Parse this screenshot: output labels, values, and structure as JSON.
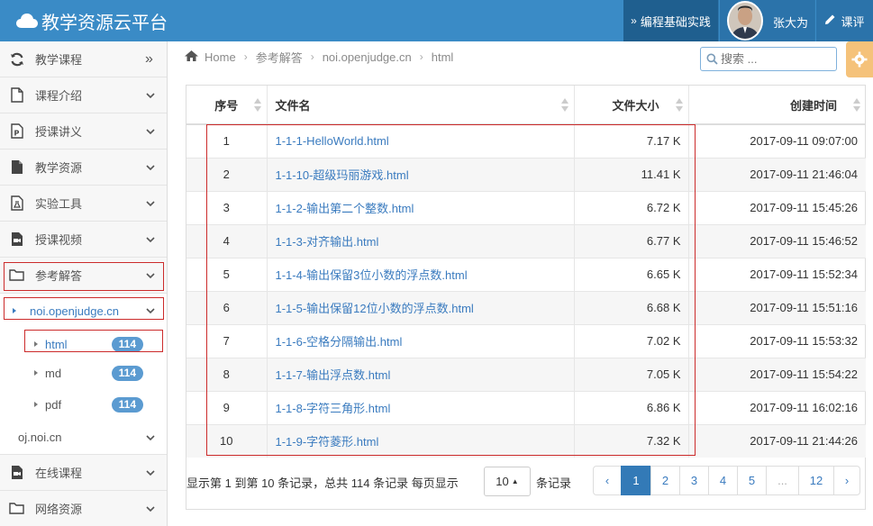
{
  "header": {
    "brand_title": "教学资源云平台",
    "nav_programming": "编程基础实践",
    "user_name": "张大为",
    "nav_evaluation": "课评",
    "color_primary": "#3a8bc6",
    "color_dark": "#1f5f8f"
  },
  "sidebar": {
    "items": [
      {
        "label": "教学课程",
        "icon": "refresh-icon"
      },
      {
        "label": "课程介绍",
        "icon": "file-icon"
      },
      {
        "label": "授课讲义",
        "icon": "ppt-file-icon"
      },
      {
        "label": "教学资源",
        "icon": "file-solid-icon"
      },
      {
        "label": "实验工具",
        "icon": "flask-file-icon"
      },
      {
        "label": "授课视频",
        "icon": "video-file-icon"
      },
      {
        "label": "参考解答",
        "icon": "folder-open-icon"
      }
    ],
    "sub_openjudge": "noi.openjudge.cn",
    "leaf_html": "html",
    "leaf_html_count": "114",
    "leaf_md": "md",
    "leaf_md_count": "114",
    "leaf_pdf": "pdf",
    "leaf_pdf_count": "114",
    "sub_oj": "oj.noi.cn",
    "items_bottom": [
      {
        "label": "在线课程",
        "icon": "video-file-icon"
      },
      {
        "label": "网络资源",
        "icon": "folder-icon"
      }
    ]
  },
  "breadcrumb": {
    "home": "Home",
    "level1": "参考解答",
    "level2": "noi.openjudge.cn",
    "level3": "html"
  },
  "search": {
    "placeholder": "搜索 ..."
  },
  "table": {
    "headers": [
      "序号",
      "文件名",
      "文件大小",
      "创建时间"
    ],
    "rows": [
      {
        "no": "1",
        "name": "1-1-1-HelloWorld.html",
        "size": "7.17 K",
        "time": "2017-09-11 09:07:00"
      },
      {
        "no": "2",
        "name": "1-1-10-超级玛丽游戏.html",
        "size": "11.41 K",
        "time": "2017-09-11 21:46:04"
      },
      {
        "no": "3",
        "name": "1-1-2-输出第二个整数.html",
        "size": "6.72 K",
        "time": "2017-09-11 15:45:26"
      },
      {
        "no": "4",
        "name": "1-1-3-对齐输出.html",
        "size": "6.77 K",
        "time": "2017-09-11 15:46:52"
      },
      {
        "no": "5",
        "name": "1-1-4-输出保留3位小数的浮点数.html",
        "size": "6.65 K",
        "time": "2017-09-11 15:52:34"
      },
      {
        "no": "6",
        "name": "1-1-5-输出保留12位小数的浮点数.html",
        "size": "6.68 K",
        "time": "2017-09-11 15:51:16"
      },
      {
        "no": "7",
        "name": "1-1-6-空格分隔输出.html",
        "size": "7.02 K",
        "time": "2017-09-11 15:53:32"
      },
      {
        "no": "8",
        "name": "1-1-7-输出浮点数.html",
        "size": "7.05 K",
        "time": "2017-09-11 15:54:22"
      },
      {
        "no": "9",
        "name": "1-1-8-字符三角形.html",
        "size": "6.86 K",
        "time": "2017-09-11 16:02:16"
      },
      {
        "no": "10",
        "name": "1-1-9-字符菱形.html",
        "size": "7.32 K",
        "time": "2017-09-11 21:44:26"
      }
    ]
  },
  "footer": {
    "info": "显示第 1 到第 10 条记录，总共 114 条记录 每页显示",
    "page_size": "10",
    "info_suffix": "条记录",
    "pages": [
      "‹",
      "1",
      "2",
      "3",
      "4",
      "5",
      "...",
      "12",
      "›"
    ],
    "active_page": "1"
  }
}
